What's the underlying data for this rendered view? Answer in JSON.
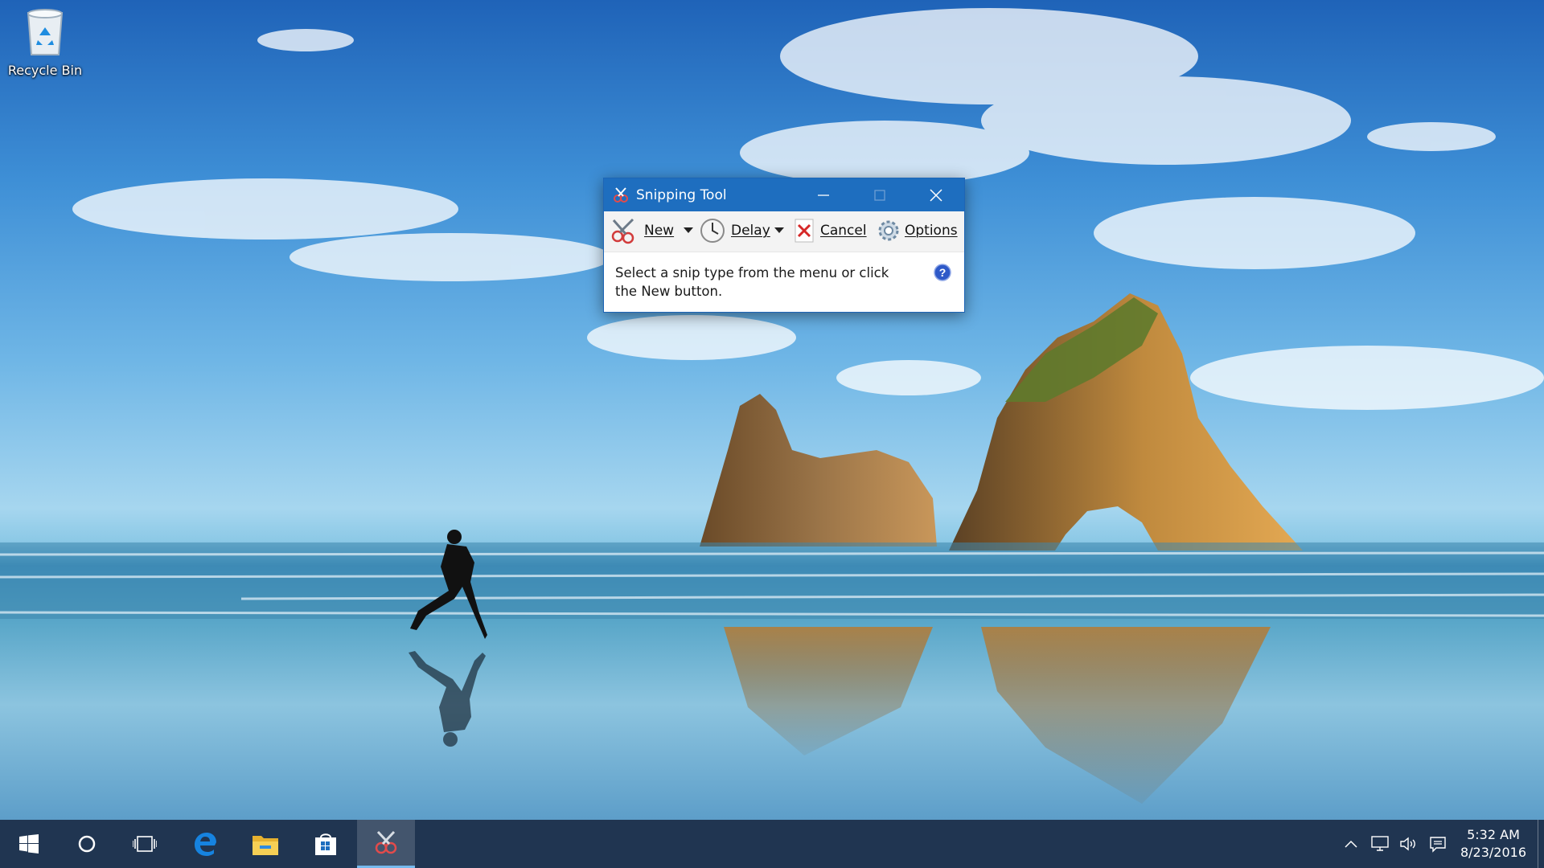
{
  "desktop": {
    "icons": [
      {
        "label": "Recycle Bin",
        "icon": "recycle-bin-icon"
      }
    ]
  },
  "window": {
    "title": "Snipping Tool",
    "controls": {
      "minimize": "minimize-icon",
      "maximize": "maximize-icon",
      "close": "close-icon"
    },
    "toolbar": {
      "new_label": "New",
      "delay_label": "Delay",
      "cancel_label": "Cancel",
      "options_label": "Options"
    },
    "message": "Select a snip type from the menu or click the New button.",
    "help_icon": "help-icon"
  },
  "taskbar": {
    "pinned": [
      "start-icon",
      "cortana-search-icon",
      "task-view-icon",
      "edge-icon",
      "file-explorer-icon",
      "store-icon",
      "snipping-tool-icon"
    ],
    "active": "snipping-tool-icon",
    "tray": [
      "show-hidden-icons",
      "network-icon",
      "volume-icon",
      "action-center-icon"
    ],
    "clock": {
      "time": "5:32 AM",
      "date": "8/23/2016"
    }
  },
  "colors": {
    "titlebar": "#1e6ebf",
    "taskbar": "#12284a",
    "accent": "#76b9ed"
  }
}
